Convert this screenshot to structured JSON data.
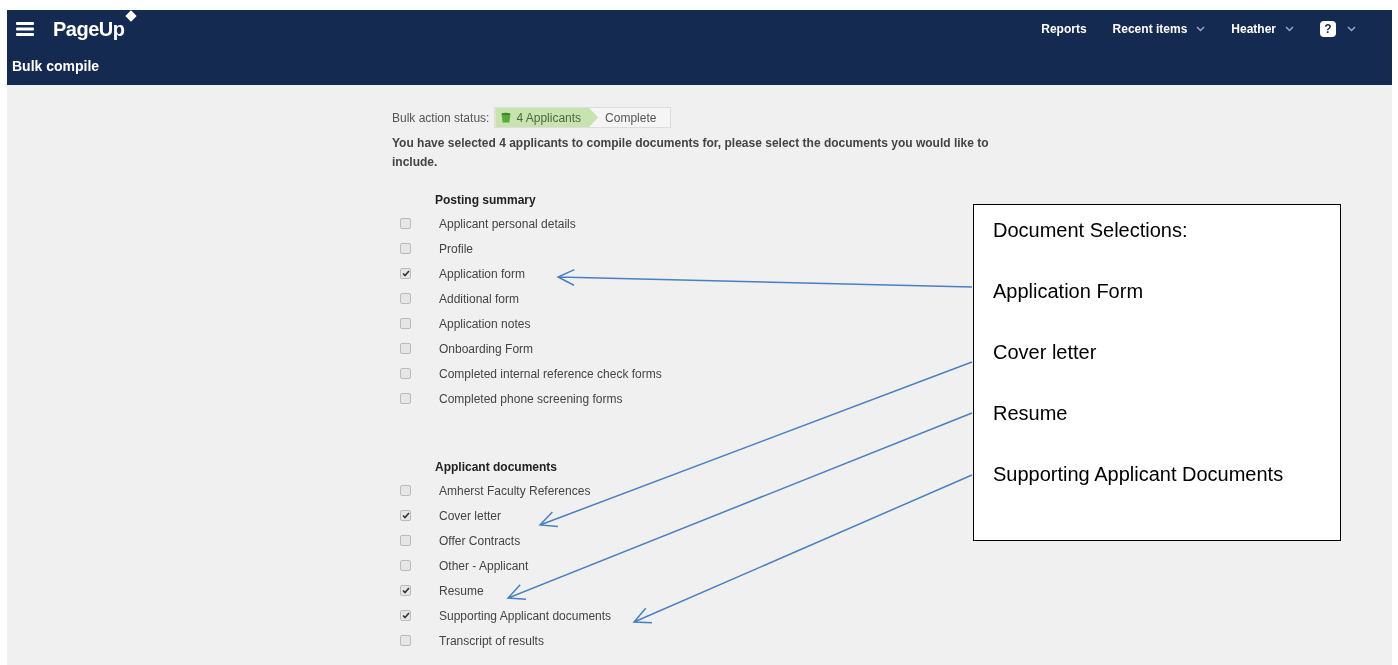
{
  "header": {
    "logo": "PageUp",
    "nav": [
      {
        "label": "Reports",
        "dropdown": false
      },
      {
        "label": "Recent items",
        "dropdown": true
      },
      {
        "label": "Heather",
        "dropdown": true
      }
    ],
    "help": "?",
    "page_title": "Bulk compile"
  },
  "status": {
    "label": "Bulk action status:",
    "steps": [
      {
        "label": "4 Applicants",
        "selected": true
      },
      {
        "label": "Complete",
        "selected": false
      }
    ]
  },
  "intro": "You have selected 4 applicants to compile documents for, please select the documents you would like to include.",
  "sections": [
    {
      "title": "Posting summary",
      "items": [
        {
          "label": "Applicant personal details",
          "checked": false
        },
        {
          "label": "Profile",
          "checked": false
        },
        {
          "label": "Application form",
          "checked": true
        },
        {
          "label": "Additional form",
          "checked": false
        },
        {
          "label": "Application notes",
          "checked": false
        },
        {
          "label": "Onboarding Form",
          "checked": false
        },
        {
          "label": "Completed internal reference check forms",
          "checked": false
        },
        {
          "label": "Completed phone screening forms",
          "checked": false
        }
      ]
    },
    {
      "title": "Applicant documents",
      "items": [
        {
          "label": "Amherst Faculty References",
          "checked": false
        },
        {
          "label": "Cover letter",
          "checked": true
        },
        {
          "label": "Offer Contracts",
          "checked": false
        },
        {
          "label": "Other - Applicant",
          "checked": false
        },
        {
          "label": "Resume",
          "checked": true
        },
        {
          "label": "Supporting Applicant documents",
          "checked": true
        },
        {
          "label": "Transcript of results",
          "checked": false
        }
      ]
    }
  ],
  "callout": {
    "title": "Document Selections:",
    "items": [
      "Application Form",
      "Cover letter",
      "Resume",
      "Supporting Applicant Documents"
    ]
  }
}
